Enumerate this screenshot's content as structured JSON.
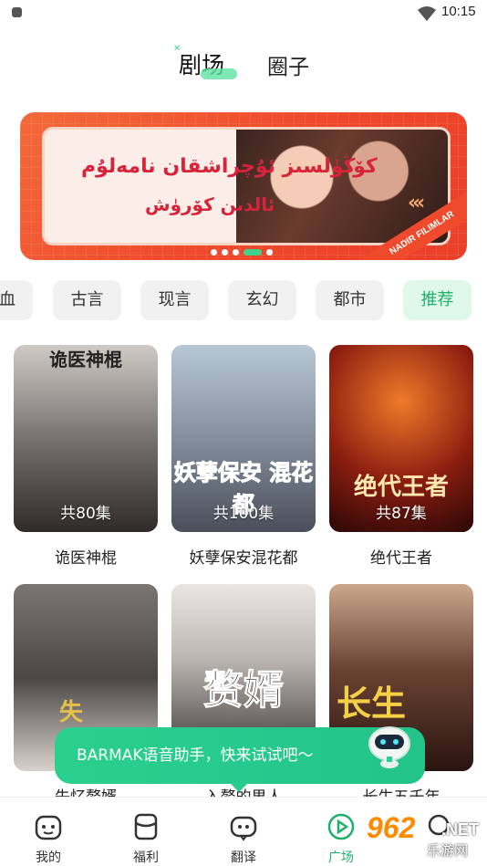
{
  "status_bar": {
    "time": "10:15"
  },
  "top_tabs": {
    "active": "剧场",
    "second": "圈子"
  },
  "banner": {
    "line1": "كۆڭۈلسىز ئۇچراشقان نامەلۇم",
    "line2": "ئالدىن كۆرۈش",
    "ribbon": "NADIR FILIMLAR",
    "active_dot": 3,
    "dot_count": 5
  },
  "categories": [
    "血",
    "古言",
    "现言",
    "玄幻",
    "都市",
    "推荐"
  ],
  "active_category": "推荐",
  "dramas": [
    {
      "title": "诡医神棍",
      "episodes": "共80集",
      "art_text": "",
      "top_text": "诡医神棍"
    },
    {
      "title": "妖孽保安混花都",
      "episodes": "共100集",
      "art_text": "妖孽保安 混花都",
      "top_text": ""
    },
    {
      "title": "绝代王者",
      "episodes": "共87集",
      "art_text": "绝代王者",
      "top_text": ""
    },
    {
      "title": "失忆赘婿",
      "episodes": "",
      "art_text": "失",
      "top_text": ""
    },
    {
      "title": "入赘的男人",
      "episodes": "",
      "art_text": "赘婿",
      "top_text": ""
    },
    {
      "title": "长生五千年",
      "episodes": "",
      "art_text": "长生",
      "top_text": ""
    }
  ],
  "assistant_tip": "BARMAK语音助手，快来试试吧～",
  "tabbar": [
    {
      "label": "我的",
      "icon": "face-icon"
    },
    {
      "label": "福利",
      "icon": "cup-icon"
    },
    {
      "label": "翻译",
      "icon": "robot-icon"
    },
    {
      "label": "广场",
      "icon": "play-icon"
    },
    {
      "label": "我的",
      "icon": "profile-icon"
    }
  ],
  "active_tab": "广场",
  "watermark": {
    "num": "962",
    "net": ".NET",
    "cn": "乐游网"
  },
  "colors": {
    "accent": "#1fb16b",
    "banner": "#ef4a2c",
    "tip": "#2bd08d"
  }
}
